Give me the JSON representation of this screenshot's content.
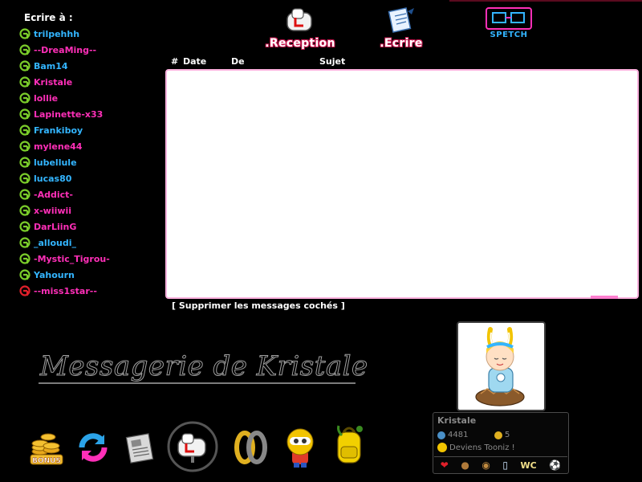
{
  "sidebar": {
    "title": "Ecrire à :",
    "contacts": [
      {
        "name": "trilpehhh",
        "color": "blue"
      },
      {
        "name": "--DreaMing--",
        "color": "pink"
      },
      {
        "name": "Bam14",
        "color": "blue"
      },
      {
        "name": "Kristale",
        "color": "pink"
      },
      {
        "name": "lollie",
        "color": "pink"
      },
      {
        "name": "Lapinette-x33",
        "color": "pink"
      },
      {
        "name": "Frankiboy",
        "color": "blue"
      },
      {
        "name": "mylene44",
        "color": "pink"
      },
      {
        "name": "lubellule",
        "color": "blue"
      },
      {
        "name": "lucas80",
        "color": "blue"
      },
      {
        "name": "-Addict-",
        "color": "pink"
      },
      {
        "name": "x-wiiwii",
        "color": "pink"
      },
      {
        "name": "DarLiinG",
        "color": "pink"
      },
      {
        "name": "_alloudi_",
        "color": "blue"
      },
      {
        "name": "-Mystic_Tigrou-",
        "color": "pink"
      },
      {
        "name": "Yahourn",
        "color": "blue"
      },
      {
        "name": "--miss1star--",
        "color": "pink",
        "icon": "heart-user-icon"
      }
    ]
  },
  "nav": {
    "reception": ".Reception",
    "ecrire": ".Ecrire",
    "spetch": "SPETCH"
  },
  "table": {
    "col_num": "#",
    "col_date": "Date",
    "col_de": "De",
    "col_sujet": "Sujet"
  },
  "delete_link": "[ Supprimer les messages cochés ]",
  "page_title": "Messagerie de Kristale",
  "profile": {
    "name": "Kristale",
    "points": "4481",
    "coins": "5",
    "status": "Deviens Tooniz !"
  },
  "toolbar": {
    "bonus_label": "BONUS"
  },
  "colors": {
    "blue": "#33b5ff",
    "pink": "#ff2fb8",
    "accent": "#c8174f"
  }
}
